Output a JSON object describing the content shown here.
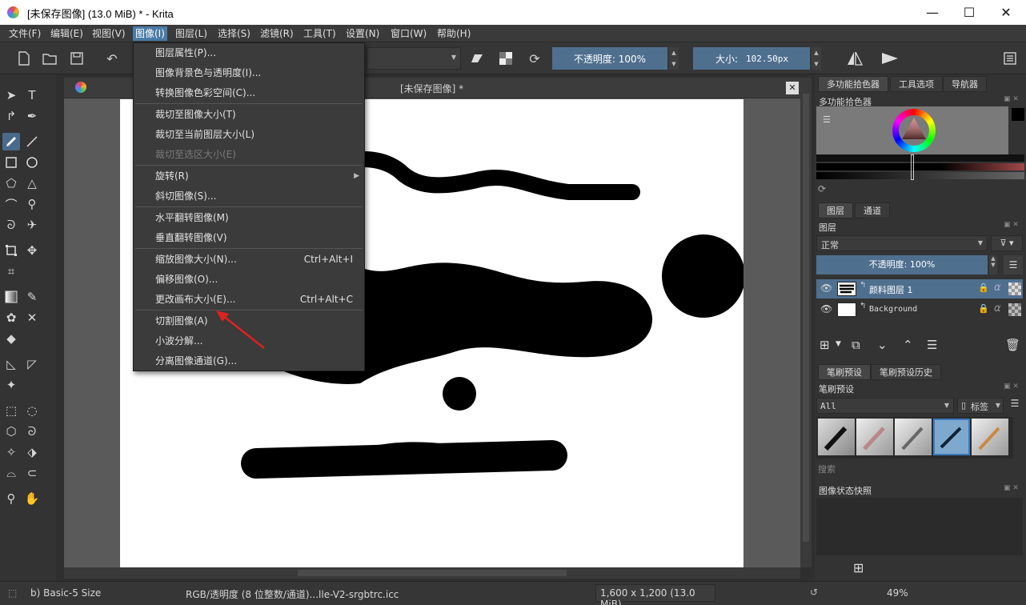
{
  "window": {
    "title": "[未保存图像]  (13.0 MiB)  * - Krita",
    "minimize": "—",
    "maximize": "☐",
    "close": "✕"
  },
  "menubar": {
    "items": [
      "文件(F)",
      "编辑(E)",
      "视图(V)",
      "图像(I)",
      "图层(L)",
      "选择(S)",
      "滤镜(R)",
      "工具(T)",
      "设置(N)",
      "窗口(W)",
      "帮助(H)"
    ],
    "active": "图像(I)"
  },
  "toolbar": {
    "opacity_label": "不透明度: 100%",
    "size_label": "大小:",
    "size_value": "102.50px"
  },
  "image_menu": {
    "items": [
      {
        "label": "图层属性(P)...",
        "shortcut": "",
        "disabled": false
      },
      {
        "label": "图像背景色与透明度(I)...",
        "shortcut": "",
        "disabled": false
      },
      {
        "label": "转换图像色彩空间(C)...",
        "shortcut": "",
        "disabled": false
      },
      {
        "label": "裁切至图像大小(T)",
        "shortcut": "",
        "disabled": false
      },
      {
        "label": "裁切至当前图层大小(L)",
        "shortcut": "",
        "disabled": false
      },
      {
        "label": "裁切至选区大小(E)",
        "shortcut": "",
        "disabled": true
      },
      {
        "label": "旋转(R)",
        "shortcut": "",
        "disabled": false,
        "submenu": true
      },
      {
        "label": "斜切图像(S)...",
        "shortcut": "",
        "disabled": false
      },
      {
        "label": "水平翻转图像(M)",
        "shortcut": "",
        "disabled": false
      },
      {
        "label": "垂直翻转图像(V)",
        "shortcut": "",
        "disabled": false
      },
      {
        "label": "缩放图像大小(N)...",
        "shortcut": "Ctrl+Alt+I",
        "disabled": false
      },
      {
        "label": "偏移图像(O)...",
        "shortcut": "",
        "disabled": false
      },
      {
        "label": "更改画布大小(E)...",
        "shortcut": "Ctrl+Alt+C",
        "disabled": false
      },
      {
        "label": "切割图像(A)",
        "shortcut": "",
        "disabled": false
      },
      {
        "label": "小波分解...",
        "shortcut": "",
        "disabled": false
      },
      {
        "label": "分离图像通道(G)...",
        "shortcut": "",
        "disabled": false
      }
    ]
  },
  "document": {
    "tab_title": "[未保存图像]  *",
    "close": "✕"
  },
  "dock": {
    "top_tabs": [
      "多功能拾色器",
      "工具选项",
      "导航器"
    ],
    "color_panel_title": "多功能拾色器",
    "layer_tabs": [
      "图层",
      "通道"
    ],
    "layers_title": "图层",
    "blend_mode": "正常",
    "layer_opacity": "不透明度:  100%",
    "layers": [
      {
        "name": "颜料图层  1"
      },
      {
        "name": "Background"
      }
    ],
    "brush_tabs": [
      "笔刷预设",
      "笔刷预设历史"
    ],
    "brush_title": "笔刷预设",
    "brush_filter": "All",
    "brush_tag": "标签",
    "brush_search": "搜索",
    "snapshot_title": "图像状态快照"
  },
  "statusbar": {
    "brush": "b) Basic-5 Size",
    "colorspace": "RGB/透明度 (8 位整数/通道)...lle-V2-srgbtrc.icc",
    "dimensions": "1,600 x 1,200 (13.0 MiB)",
    "zoom": "49%"
  },
  "colors": {
    "accent": "#4a7ba6",
    "field_blue": "#4f6f8f",
    "arrow": "#e02020"
  }
}
